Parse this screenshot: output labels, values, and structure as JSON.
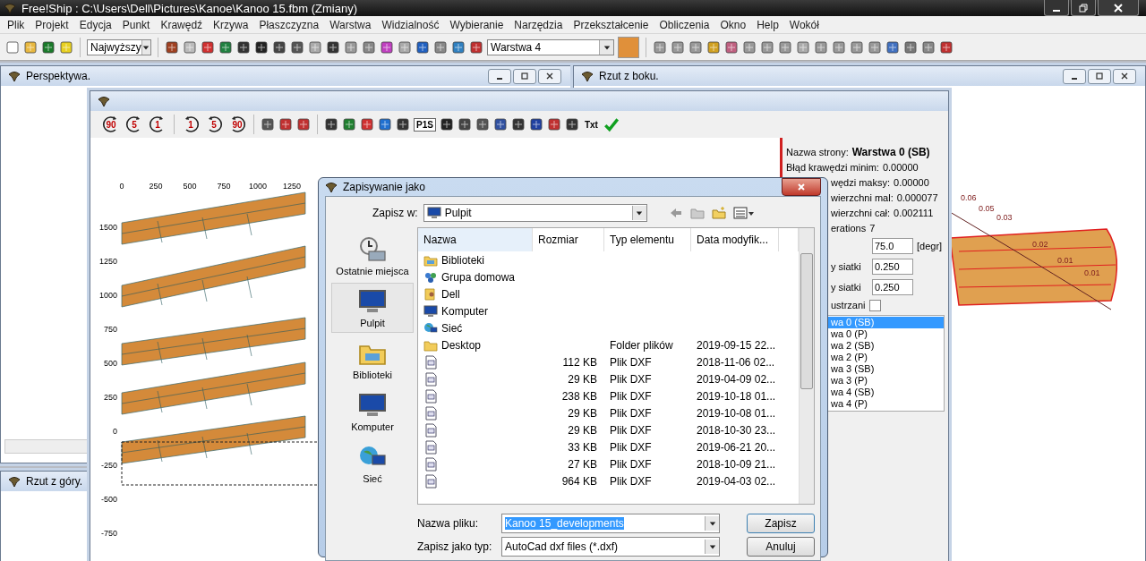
{
  "app_window": {
    "title": "Free!Ship  : C:\\Users\\Dell\\Pictures\\Kanoe\\Kanoo 15.fbm (Zmiany)"
  },
  "menu": [
    "Plik",
    "Projekt",
    "Edycja",
    "Punkt",
    "Krawędź",
    "Krzywa",
    "Płaszczyzna",
    "Warstwa",
    "Widzialność",
    "Wybieranie",
    "Narzędzia",
    "Przekształcenie",
    "Obliczenia",
    "Okno",
    "Help",
    "Wokół"
  ],
  "toolbar": {
    "precision_combo": "Najwyższy",
    "layer_combo": "Warstwa 4"
  },
  "windows": [
    {
      "title": "Perspektywa."
    },
    {
      "title": "Rzut z boku."
    },
    {
      "title": "Rzut z góry."
    }
  ],
  "side_view": {
    "contour_labels": [
      "0.06",
      "0.05",
      "0.03",
      "0.02",
      "0.01",
      "0.01"
    ]
  },
  "developments_window": {
    "rotate_left_buttons": [
      "90",
      "5",
      "1"
    ],
    "rotate_right_buttons": [
      "1",
      "5",
      "90"
    ],
    "text_buttons": [
      "P1S",
      "Txt"
    ],
    "x_ticks": [
      "0",
      "250",
      "500",
      "750",
      "1000",
      "1250"
    ],
    "y_ticks": [
      "1500",
      "1250",
      "1000",
      "750",
      "500",
      "250",
      "0",
      "-250",
      "-500",
      "-750"
    ],
    "info_panel": {
      "page_name_label": "Nazwa strony:",
      "page_name": "Warstwa 0 (SB)",
      "rows": [
        {
          "kind": "text",
          "label": "Błąd krawędzi minim:",
          "value": "0.00000"
        },
        {
          "kind": "text",
          "label": "wędzi maksy:",
          "value": "0.00000"
        },
        {
          "kind": "text",
          "label": "wierzchni mal:",
          "value": "0.000077"
        },
        {
          "kind": "text",
          "label": "wierzchni cał:",
          "value": "0.002111"
        },
        {
          "kind": "text",
          "label": "erations",
          "value": "7"
        },
        {
          "kind": "field",
          "value": "75.0",
          "unit": "[degr]"
        },
        {
          "kind": "field",
          "label": "y siatki",
          "value": "0.250"
        },
        {
          "kind": "field",
          "label": "y siatki",
          "value": "0.250"
        },
        {
          "kind": "checkbox",
          "label": "ustrzani",
          "checked": false
        }
      ],
      "layers": [
        {
          "label": "wa 0 (SB)",
          "selected": true
        },
        {
          "label": "wa 0 (P)",
          "selected": false
        },
        {
          "label": "wa 2 (SB)",
          "selected": false
        },
        {
          "label": "wa 2 (P)",
          "selected": false
        },
        {
          "label": "wa 3 (SB)",
          "selected": false
        },
        {
          "label": "wa 3 (P)",
          "selected": false
        },
        {
          "label": "wa 4 (SB)",
          "selected": false
        },
        {
          "label": "wa 4 (P)",
          "selected": false
        }
      ]
    }
  },
  "save_dialog": {
    "title": "Zapisywanie jako",
    "save_in_label": "Zapisz w:",
    "save_in": "Pulpit",
    "places": [
      {
        "kind": "recent",
        "label": "Ostatnie miejsca",
        "selected": false
      },
      {
        "kind": "desktop",
        "label": "Pulpit",
        "selected": true
      },
      {
        "kind": "library",
        "label": "Biblioteki",
        "selected": false
      },
      {
        "kind": "computer",
        "label": "Komputer",
        "selected": false
      },
      {
        "kind": "network",
        "label": "Sieć",
        "selected": false
      }
    ],
    "columns": [
      "Nazwa",
      "Rozmiar",
      "Typ elementu",
      "Data modyfik..."
    ],
    "rows": [
      {
        "kind": "library",
        "name": "Biblioteki"
      },
      {
        "kind": "homegroup",
        "name": "Grupa domowa"
      },
      {
        "kind": "user",
        "name": "Dell"
      },
      {
        "kind": "computer",
        "name": "Komputer"
      },
      {
        "kind": "network",
        "name": "Sieć"
      },
      {
        "kind": "folder",
        "name": "Desktop",
        "type": "Folder plików",
        "date": "2019-09-15 22..."
      },
      {
        "kind": "dxf",
        "size": "112 KB",
        "type": "Plik DXF",
        "date": "2018-11-06 02..."
      },
      {
        "kind": "dxf",
        "size": "29 KB",
        "type": "Plik DXF",
        "date": "2019-04-09 02..."
      },
      {
        "kind": "dxf",
        "size": "238 KB",
        "type": "Plik DXF",
        "date": "2019-10-18 01..."
      },
      {
        "kind": "dxf",
        "size": "29 KB",
        "type": "Plik DXF",
        "date": "2019-10-08 01..."
      },
      {
        "kind": "dxf",
        "size": "29 KB",
        "type": "Plik DXF",
        "date": "2018-10-30 23..."
      },
      {
        "kind": "dxf",
        "size": "33 KB",
        "type": "Plik DXF",
        "date": "2019-06-21 20..."
      },
      {
        "kind": "dxf",
        "size": "27 KB",
        "type": "Plik DXF",
        "date": "2018-10-09 21..."
      },
      {
        "kind": "dxf",
        "size": "964 KB",
        "type": "Plik DXF",
        "date": "2019-04-03 02..."
      }
    ],
    "file_name_label": "Nazwa pliku:",
    "file_name": "Kanoo 15_developments",
    "file_type_label": "Zapisz jako typ:",
    "file_type": "AutoCad dxf files (*.dxf)",
    "buttons": [
      "Zapisz",
      "Anuluj"
    ]
  }
}
